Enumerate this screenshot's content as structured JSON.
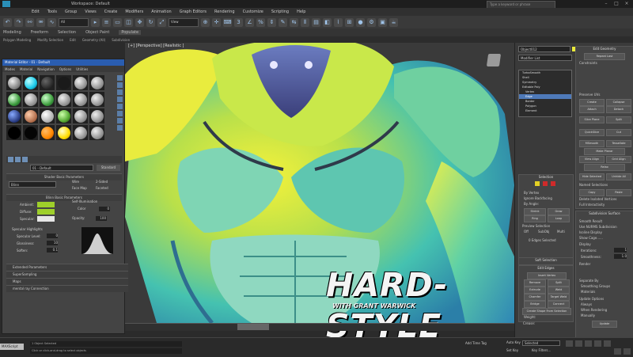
{
  "app": {
    "title": "Workspace: Default",
    "search_placeholder": "Type a keyword or phrase"
  },
  "menu": [
    "Edit",
    "Tools",
    "Group",
    "Views",
    "Create",
    "Modifiers",
    "Animation",
    "Graph Editors",
    "Rendering",
    "Customize",
    "Scripting",
    "Help"
  ],
  "toolbar": {
    "selection_filter": "All",
    "ref_coord": "View"
  },
  "ribbon": {
    "tabs": [
      "Modeling",
      "Freeform",
      "Selection",
      "Object Paint",
      "Populate"
    ],
    "active": "Populate",
    "subtabs": [
      "Polygon Modeling",
      "Modify Selection",
      "Edit",
      "Geometry (All)",
      "Subdivision"
    ]
  },
  "viewport": {
    "label": "[+] [Perspective] [Realistic ]",
    "overlay_title": "HARD-STYLE",
    "overlay_subtitle": "WITH GRANT WARWICK"
  },
  "material_editor": {
    "title": "Material Editor - 01 - Default",
    "menu": [
      "Modes",
      "Material",
      "Navigation",
      "Options",
      "Utilities"
    ],
    "material_name": "01 - Default",
    "material_type": "Standard",
    "sections": {
      "shader_basic": "Shader Basic Parameters",
      "shader": "Blinn",
      "wire": "Wire",
      "two_sided": "2-Sided",
      "face_map": "Face Map",
      "faceted": "Faceted",
      "blinn_basic": "Blinn Basic Parameters",
      "ambient": "Ambient:",
      "diffuse": "Diffuse:",
      "specular": "Specular:",
      "self_illum": "Self-Illumination",
      "color": "Color",
      "opacity": "Opacity:",
      "spec_highlights": "Specular Highlights",
      "spec_level": "Specular Level:",
      "glossiness": "Glossiness:",
      "soften": "Soften:",
      "extended": "Extended Parameters",
      "supersampling": "SuperSampling",
      "maps": "Maps",
      "mental_ray": "mental ray Connection"
    },
    "values": {
      "color_value": "0",
      "opacity_value": "100",
      "spec_level_value": "0",
      "glossiness_value": "10",
      "soften_value": "0.1"
    }
  },
  "command_panel": {
    "object_name": "Object012",
    "modifier_list": "Modifier List",
    "stack": [
      "TurboSmooth",
      "Shell",
      "Symmetry",
      "Editable Poly",
      "Vertex",
      "Edge",
      "Border",
      "Polygon",
      "Element"
    ],
    "stack_selected": "Edge",
    "selection": "Selection",
    "by_vertex": "By Vertex",
    "ignore_backfacing": "Ignore Backfacing",
    "by_angle": "By Angle:",
    "shrink": "Shrink",
    "grow": "Grow",
    "ring": "Ring",
    "loop": "Loop",
    "preview_selection": "Preview Selection",
    "off": "Off",
    "subobj": "SubObj",
    "multi": "Multi",
    "edges_selected": "0 Edges Selected",
    "soft_selection": "Soft Selection",
    "edit_edges": "Edit Edges",
    "insert_vertex": "Insert Vertex",
    "remove": "Remove",
    "split": "Split",
    "extrude": "Extrude",
    "weld": "Weld",
    "chamfer": "Chamfer",
    "target_weld": "Target Weld",
    "bridge": "Bridge",
    "connect": "Connect",
    "create_shape": "Create Shape From Selection",
    "weight": "Weight:",
    "crease": "Crease:",
    "edit_geometry": "Edit Geometry",
    "repeat_last": "Repeat Last",
    "constraints": "Constraints",
    "preserve_uvs": "Preserve UVs",
    "create": "Create",
    "collapse": "Collapse",
    "attach": "Attach",
    "detach": "Detach",
    "slice_plane": "Slice Plane",
    "split_btn": "Split",
    "quickslice": "QuickSlice",
    "cut": "Cut",
    "msmooth": "MSmooth",
    "tessellate": "Tessellate",
    "make_planar": "Make Planar",
    "view_align": "View Align",
    "grid_align": "Grid Align",
    "relax": "Relax",
    "hide_selected": "Hide Selected",
    "unhide_all": "Unhide All",
    "named_selections": "Named Selections",
    "copy": "Copy",
    "paste": "Paste",
    "delete_isolated": "Delete Isolated Vertices",
    "full_interactivity": "Full Interactivity",
    "subdivision_surface": "Subdivision Surface",
    "smooth_result": "Smooth Result",
    "use_nurms": "Use NURMS Subdivision",
    "isoline_display": "Isoline Display",
    "show_cage": "Show Cage......",
    "display": "Display",
    "iterations": "Iterations:",
    "smoothness": "Smoothness:",
    "render": "Render",
    "separate_by": "Separate By",
    "smoothing_groups": "Smoothing Groups",
    "materials": "Materials",
    "update_options": "Update Options",
    "always": "Always",
    "when_rendering": "When Rendering",
    "manually": "Manually",
    "update": "Update",
    "iter_value": "1",
    "smooth_value": "1.0"
  },
  "status": {
    "maxscript": "MAXScript",
    "objects_selected": "1 Object Selected",
    "prompt": "Click or click-and-drag to select objects",
    "add_time_tag": "Add Time Tag",
    "selected": "Selected",
    "key_filters": "Key Filters...",
    "auto_key": "Auto Key",
    "set_key": "Set Key",
    "frame": "0 / 100"
  }
}
